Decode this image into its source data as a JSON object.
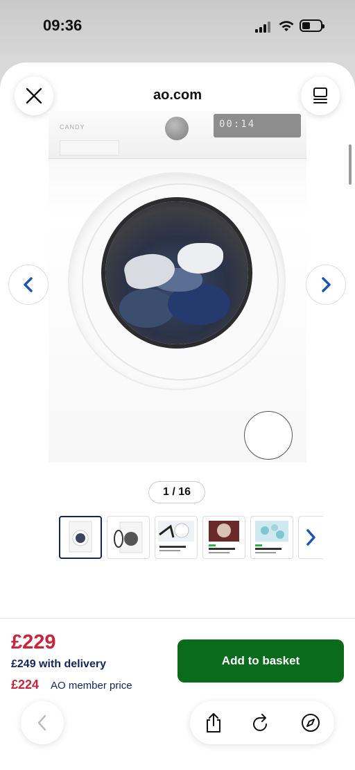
{
  "status_bar": {
    "time": "09:36"
  },
  "header": {
    "url": "ao.com"
  },
  "product_image": {
    "display_readout": "00:14",
    "brand_text": "CANDY"
  },
  "gallery": {
    "counter": "1 / 16",
    "thumbnails": [
      {
        "label": "front view"
      },
      {
        "label": "door open view"
      },
      {
        "label": "Fly through the laundry"
      },
      {
        "label": "Laundry's Instadrier"
      },
      {
        "label": "Wash, clean machine"
      }
    ]
  },
  "purchase": {
    "price": "£229",
    "delivery_text": "£249 with delivery",
    "member_price": "£224",
    "member_label": "AO member price",
    "add_to_basket": "Add to basket"
  },
  "colors": {
    "price_red": "#c8243c",
    "navy": "#13265c",
    "basket_green": "#0b6b1d",
    "arrow_blue": "#1b55b5"
  }
}
